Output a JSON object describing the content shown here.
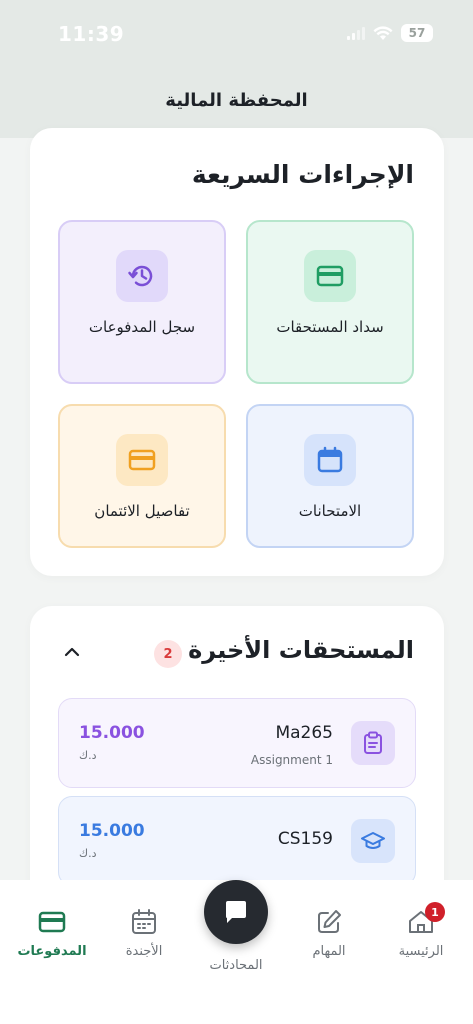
{
  "status": {
    "time": "11:39",
    "battery": "57"
  },
  "header": {
    "title": "المحفظة المالية"
  },
  "quick_actions": {
    "title": "الإجراءات السريعة",
    "items": [
      {
        "label": "سداد المستحقات",
        "icon": "credit-card-icon",
        "color": "#1f9d63"
      },
      {
        "label": "سجل المدفوعات",
        "icon": "history-icon",
        "color": "#7a4fd6"
      },
      {
        "label": "الامتحانات",
        "icon": "calendar-icon",
        "color": "#3a7be0"
      },
      {
        "label": "تفاصيل الائتمان",
        "icon": "credit-card-icon",
        "color": "#f0a020"
      }
    ]
  },
  "recent_dues": {
    "title": "المستحقات الأخيرة",
    "count": "2",
    "items": [
      {
        "code": "Ma265",
        "subtitle": "Assignment 1",
        "amount": "15.000",
        "currency": "د.ك",
        "icon": "clipboard-icon"
      },
      {
        "code": "CS159",
        "subtitle": "",
        "amount": "15.000",
        "currency": "د.ك",
        "icon": "graduation-cap-icon"
      }
    ]
  },
  "nav": {
    "payments": "المدفوعات",
    "agenda": "الأجندة",
    "chats": "المحادثات",
    "tasks": "المهام",
    "home": "الرئيسية",
    "home_badge": "1"
  }
}
